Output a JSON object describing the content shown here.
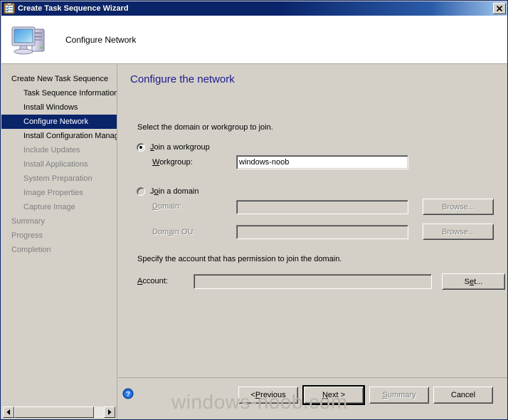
{
  "window": {
    "title": "Create Task Sequence Wizard",
    "title_icon": "task-sequence-icon",
    "close_icon": "close-icon"
  },
  "header": {
    "title": "Configure Network",
    "icon": "computer-icon"
  },
  "sidebar": {
    "items": [
      {
        "label": "Create New Task Sequence",
        "level": 1,
        "state": "normal"
      },
      {
        "label": "Task Sequence Information",
        "level": 2,
        "state": "normal"
      },
      {
        "label": "Install Windows",
        "level": 2,
        "state": "normal"
      },
      {
        "label": "Configure Network",
        "level": 2,
        "state": "selected"
      },
      {
        "label": "Install Configuration Manag",
        "level": 2,
        "state": "normal"
      },
      {
        "label": "Include Updates",
        "level": 2,
        "state": "disabled"
      },
      {
        "label": "Install Applications",
        "level": 2,
        "state": "disabled"
      },
      {
        "label": "System Preparation",
        "level": 2,
        "state": "disabled"
      },
      {
        "label": "Image Properties",
        "level": 2,
        "state": "disabled"
      },
      {
        "label": "Capture Image",
        "level": 2,
        "state": "disabled"
      },
      {
        "label": "Summary",
        "level": 1,
        "state": "disabled"
      },
      {
        "label": "Progress",
        "level": 1,
        "state": "disabled"
      },
      {
        "label": "Completion",
        "level": 1,
        "state": "disabled"
      }
    ],
    "scrollbar": {
      "left_arrow_icon": "arrow-left-icon",
      "right_arrow_icon": "arrow-right-icon"
    }
  },
  "content": {
    "heading": "Configure the network",
    "instruction_1": "Select the domain or workgroup to join.",
    "instruction_2": "Specify the account that has permission to join the domain.",
    "radio_workgroup": {
      "label": "Join a workgroup",
      "checked": true
    },
    "radio_domain": {
      "label": "Join a domain",
      "checked": false
    },
    "workgroup": {
      "label": "Workgroup:",
      "value": "windows-noob",
      "placeholder": ""
    },
    "domain": {
      "label": "Domain:",
      "value": "",
      "placeholder": "",
      "disabled": true
    },
    "domain_ou": {
      "label": "Domain OU:",
      "value": "",
      "placeholder": "",
      "disabled": true
    },
    "account": {
      "label": "Account:",
      "value": "",
      "placeholder": ""
    },
    "browse_domain_label": "Browse...",
    "browse_domainou_label": "Browse...",
    "set_label": "Set..."
  },
  "footer": {
    "help_icon": "help-icon",
    "previous_label": "< Previous",
    "next_label": "Next >",
    "summary_label": "Summary",
    "cancel_label": "Cancel"
  },
  "watermark": {
    "text": "windows-noob.com"
  },
  "colors": {
    "titlebar": "#0a246a",
    "face": "#d4d0c8",
    "heading": "#1c1c8c",
    "selection": "#0a246a",
    "disabled_text": "#808080",
    "watermark": "#b8b4ab"
  }
}
